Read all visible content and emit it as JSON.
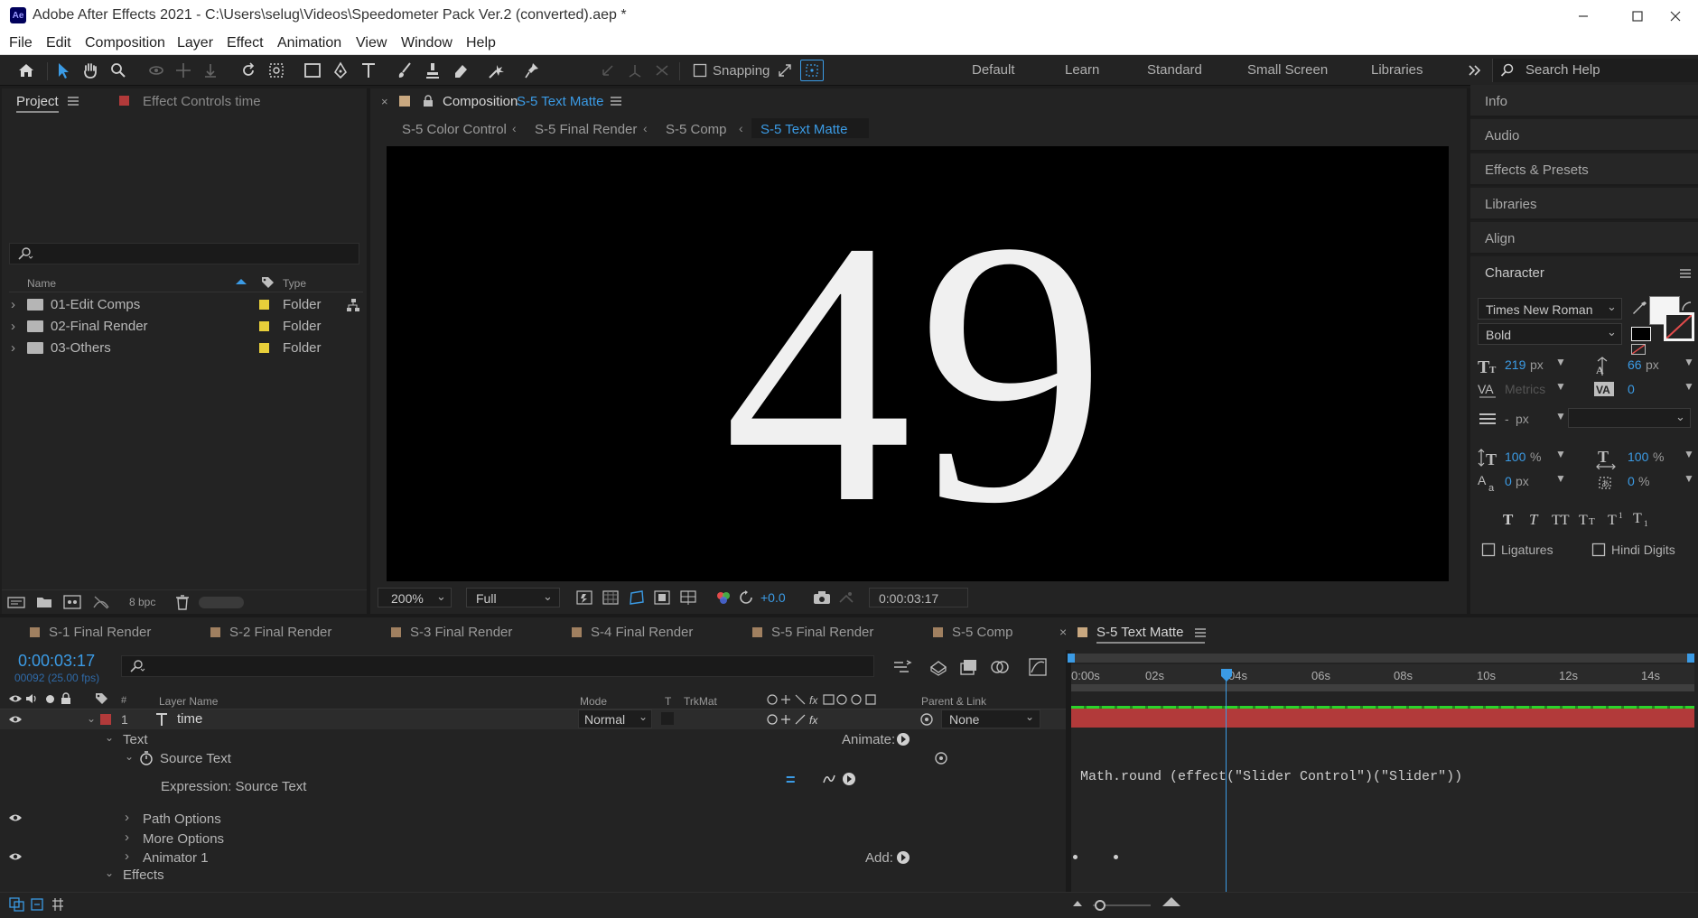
{
  "window": {
    "title": "Adobe After Effects 2021 - C:\\Users\\selug\\Videos\\Speedometer Pack Ver.2 (converted).aep *",
    "app_badge": "Ae"
  },
  "menu": [
    "File",
    "Edit",
    "Composition",
    "Layer",
    "Effect",
    "Animation",
    "View",
    "Window",
    "Help"
  ],
  "toolbar": {
    "snapping_label": "Snapping",
    "workspaces": [
      "Default",
      "Learn",
      "Standard",
      "Small Screen",
      "Libraries"
    ],
    "search_placeholder": "Search Help"
  },
  "project": {
    "tab_label": "Project",
    "effect_controls_label": "Effect Controls time",
    "columns": {
      "name": "Name",
      "type": "Type"
    },
    "items": [
      {
        "name": "01-Edit Comps",
        "type": "Folder"
      },
      {
        "name": "02-Final Render",
        "type": "Folder"
      },
      {
        "name": "03-Others",
        "type": "Folder"
      }
    ],
    "bpc": "8 bpc"
  },
  "composition": {
    "tab_prefix": "Composition",
    "tab_name": "S-5 Text Matte",
    "breadcrumbs": [
      "S-5 Color Control",
      "S-5 Final Render",
      "S-5 Comp",
      "S-5 Text Matte"
    ],
    "display_text": "49",
    "zoom": "200%",
    "resolution": "Full",
    "exposure": "+0.0",
    "timecode": "0:00:03:17"
  },
  "right_panels": [
    "Info",
    "Audio",
    "Effects & Presets",
    "Libraries",
    "Align"
  ],
  "character": {
    "title": "Character",
    "font": "Times New Roman",
    "style": "Bold",
    "font_size": "219",
    "leading": "66",
    "kerning": "Metrics",
    "tracking": "0",
    "stroke_width": "-",
    "vscale": "100",
    "hscale": "100",
    "baseline": "0",
    "tsume": "0",
    "unit_px": "px",
    "unit_pct": "%",
    "ligatures": "Ligatures",
    "hindi_digits": "Hindi Digits"
  },
  "timeline": {
    "tabs": [
      "S-1 Final Render",
      "S-2 Final Render",
      "S-3 Final Render",
      "S-4 Final Render",
      "S-5 Final Render",
      "S-5 Comp",
      "S-5 Text Matte"
    ],
    "timecode": "0:00:03:17",
    "frame_info": "00092 (25.00 fps)",
    "columns": {
      "num": "#",
      "layer_name": "Layer Name",
      "mode": "Mode",
      "t": "T",
      "trkmat": "TrkMat",
      "parent": "Parent & Link"
    },
    "ruler": [
      "0:00s",
      "02s",
      "04s",
      "06s",
      "08s",
      "10s",
      "12s",
      "14s"
    ],
    "layer": {
      "index": "1",
      "name": "time",
      "mode": "Normal",
      "parent": "None"
    },
    "props": {
      "text": "Text",
      "animate": "Animate:",
      "source_text": "Source Text",
      "expression_label": "Expression: Source Text",
      "expression": "Math.round (effect(\"Slider Control\")(\"Slider\"))",
      "path_options": "Path Options",
      "more_options": "More Options",
      "animator": "Animator 1",
      "add": "Add:",
      "effects": "Effects"
    }
  },
  "colors": {
    "accent_blue": "#3b9be5",
    "layer_red": "#b23a3a",
    "folder_yellow": "#e8cf3a",
    "label_tan": "#a08060"
  }
}
